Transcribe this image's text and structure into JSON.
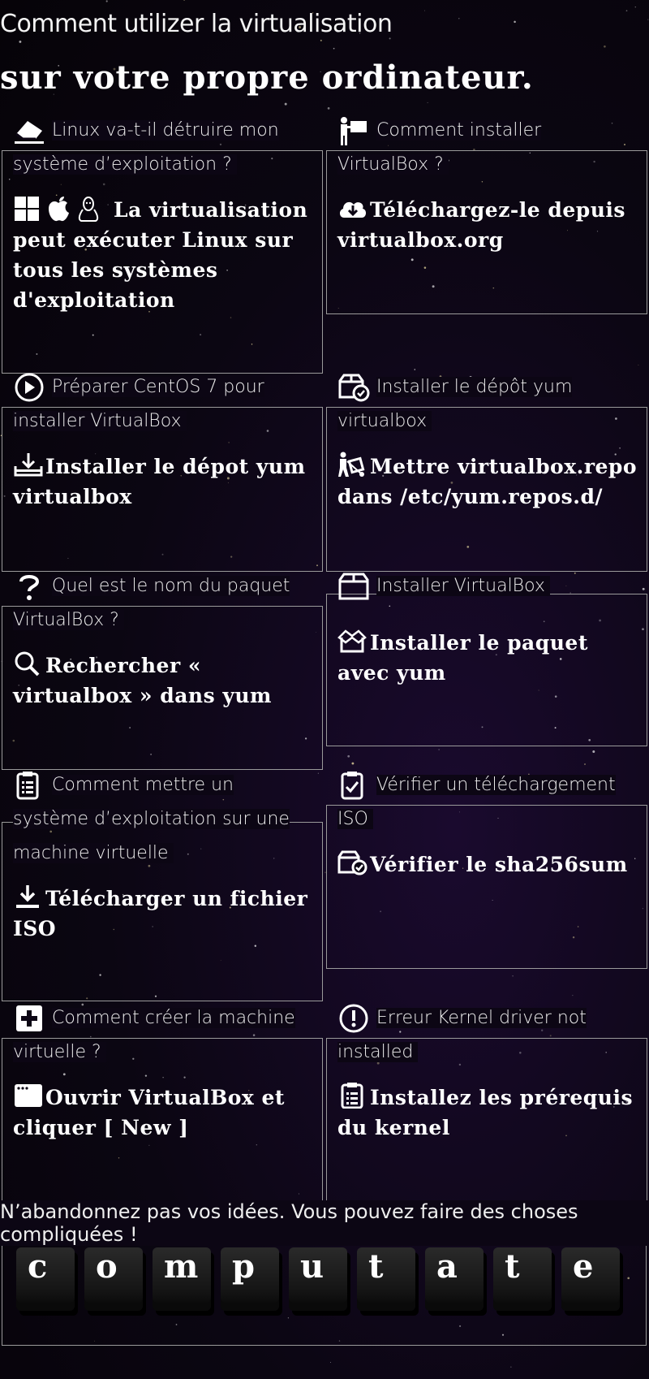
{
  "header": {
    "subtitle": "Comment utilizer la virtualisation",
    "title": "sur votre propre ordinateur."
  },
  "cards": [
    {
      "icon": "eraser-icon",
      "heading": "Linux va-t-il détruire mon système d’exploitation ?",
      "body_icon": "os-logos-icon",
      "body": "La virtualisation peut exécuter Linux sur tous les systèmes d'exploitation"
    },
    {
      "icon": "person-sign-icon",
      "heading": "Comment installer VirtualBox ?",
      "body_icon": "cloud-download-icon",
      "body": "Téléchargez-le depuis virtualbox.org"
    },
    {
      "icon": "play-circle-icon",
      "heading": "Préparer CentOS 7 pour installer VirtualBox",
      "body_icon": "tray-download-icon",
      "body": "Installer le dépot yum virtualbox"
    },
    {
      "icon": "box-check-icon",
      "heading": "Installer le dépôt yum virtualbox",
      "body_icon": "person-dolly-icon",
      "body": "Mettre virtualbox.repo dans /etc/yum.repos.d/"
    },
    {
      "icon": "question-icon",
      "heading": "Quel est le nom du paquet VirtualBox ?",
      "body_icon": "search-icon",
      "body": "Rechercher « virtualbox » dans yum"
    },
    {
      "icon": "box-icon",
      "heading": "Installer VirtualBox",
      "body_icon": "box-open-icon",
      "body": "Installer le paquet avec yum"
    },
    {
      "icon": "clipboard-list-icon",
      "heading": "Comment mettre un système d’exploitation sur une machine virtuelle",
      "body_icon": "download-icon",
      "body": "Télécharger un fichier ISO"
    },
    {
      "icon": "clipboard-check-icon",
      "heading": "Vérifier un téléchargement ISO",
      "body_icon": "box-check-icon",
      "body": "Vérifier le sha256sum"
    },
    {
      "icon": "plus-square-icon",
      "heading": "Comment créer la machine virtuelle ?",
      "body_icon": "window-icon",
      "body": "Ouvrir VirtualBox et cliquer [ New ]"
    },
    {
      "icon": "exclamation-circle-icon",
      "heading": "Erreur Kernel driver not installed",
      "body_icon": "clipboard-list-icon",
      "body": "Installez les prérequis du kernel"
    }
  ],
  "footer": {
    "text": "N’abandonnez pas vos idées. Vous pouvez faire des choses compliquées !",
    "keys": [
      "c",
      "o",
      "m",
      "p",
      "u",
      "t",
      "a",
      "t",
      "e"
    ]
  }
}
